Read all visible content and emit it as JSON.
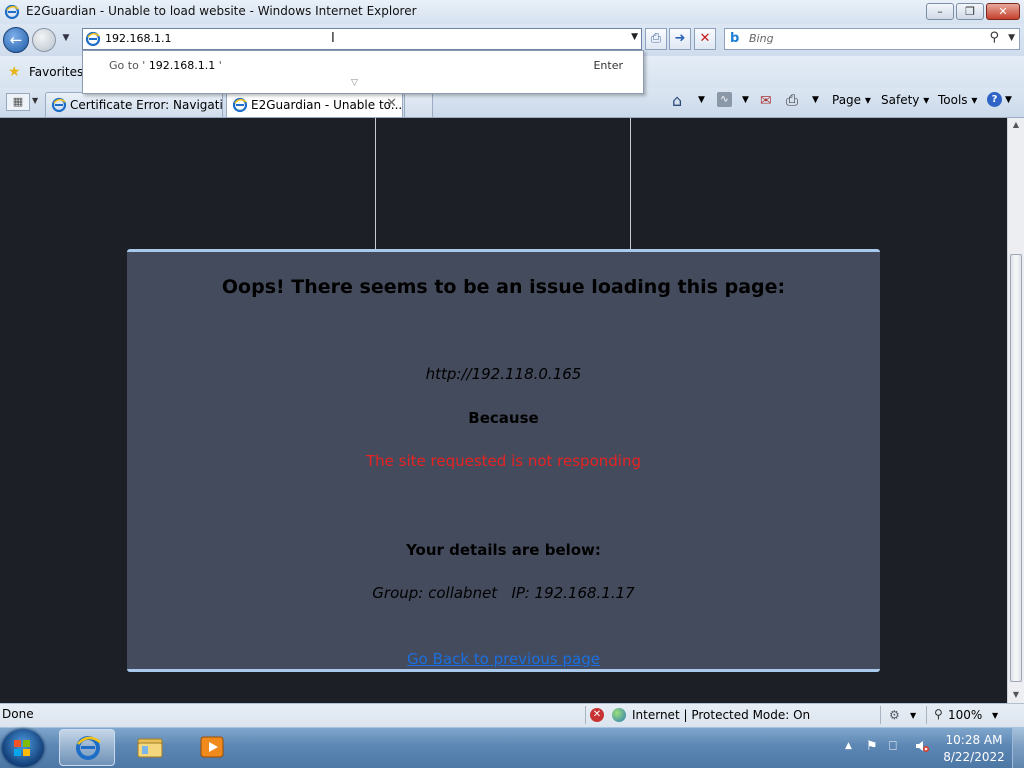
{
  "window": {
    "title": "E2Guardian - Unable to load website - Windows Internet Explorer",
    "min_label": "–",
    "max_label": "❐",
    "close_label": "✕"
  },
  "nav": {
    "address_value": "192.168.1.1",
    "search_placeholder": "Bing"
  },
  "autocomplete": {
    "goto_prefix": "Go to ' ",
    "goto_url": "192.168.1.1",
    "goto_suffix": " '",
    "enter_label": "Enter"
  },
  "favorites": {
    "label": "Favorites"
  },
  "tabs": [
    {
      "label": "Certificate Error: Navigatio...",
      "icon": "ie-icon",
      "active": false
    },
    {
      "label": "E2Guardian - Unable to...",
      "icon": "ie-icon",
      "active": true
    }
  ],
  "commands": {
    "page": "Page ▾",
    "safety": "Safety ▾",
    "tools": "Tools ▾"
  },
  "page": {
    "heading": "Oops! There seems to be an issue loading this page:",
    "url": "http://192.118.0.165",
    "because": "Because",
    "reason": "The site requested is not responding",
    "details_heading": "Your details are below:",
    "details": "Group: collabnet   IP: 192.168.1.17",
    "go_back": "Go Back to previous page"
  },
  "status": {
    "text": "Done",
    "zone": "Internet | Protected Mode: On",
    "zoom": "100%"
  },
  "taskbar": {
    "time": "10:28 AM",
    "date": "8/22/2022"
  },
  "colors": {
    "page_background": "#1c1f26",
    "error_box": "#444b5c",
    "error_box_border": "#a8c8ec",
    "reason_text": "#e82222",
    "link": "#1a6fe0"
  }
}
